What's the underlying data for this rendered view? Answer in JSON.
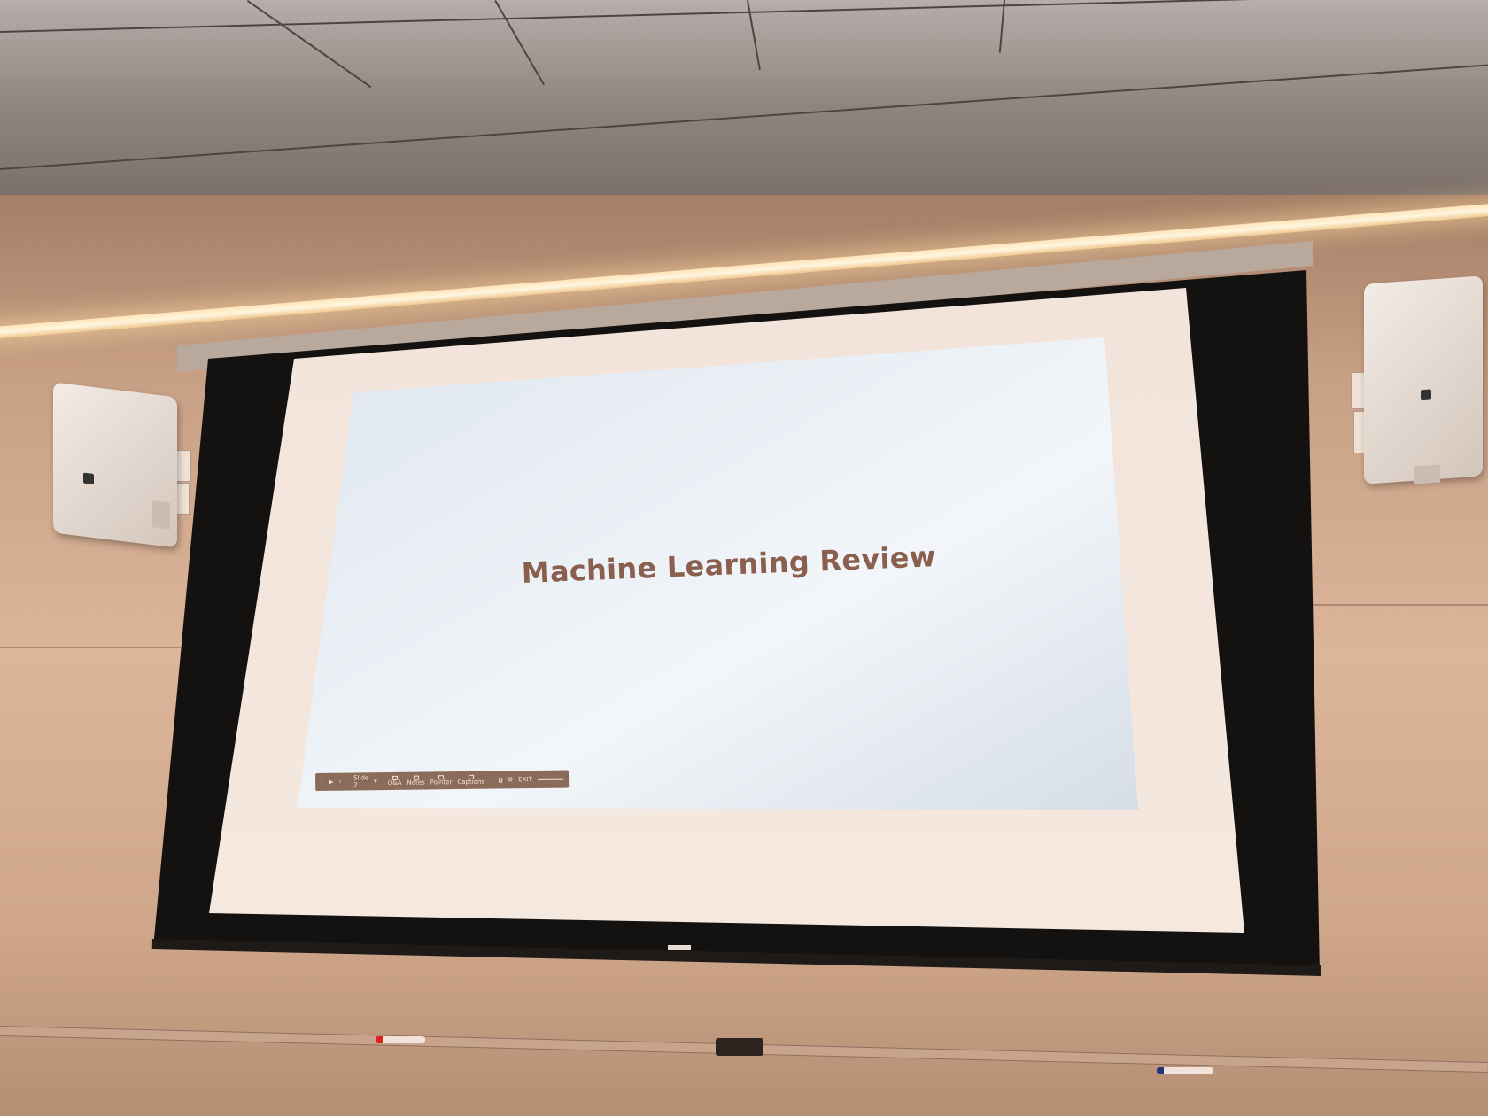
{
  "slide": {
    "title": "Machine Learning Review"
  },
  "presenter_toolbar": {
    "prev": "‹",
    "play": "▶",
    "next": "›",
    "slide_label": "Slide 2",
    "slide_dropdown": "▾",
    "qa": "Q&A",
    "notes": "Notes",
    "pointer": "Pointer",
    "captions": "Captions",
    "exit": "EXIT"
  },
  "colors": {
    "slide_background": "#e8eef4",
    "title_color": "#8a5f4d",
    "toolbar_background": "#8b6b59",
    "wall": "#d8b094",
    "screen_border": "#f3e7df",
    "screen_frame": "#141210"
  },
  "icons": {
    "qa": "chat-icon",
    "notes": "notes-icon",
    "pointer": "pen-icon",
    "captions": "captions-icon",
    "fullscreen": "square-icon",
    "settings": "gear-icon"
  }
}
